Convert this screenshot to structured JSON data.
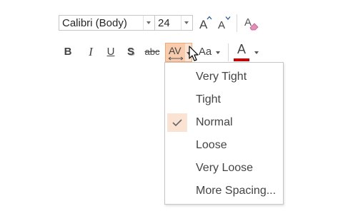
{
  "font_group": {
    "font_name": {
      "value": "Calibri (Body)"
    },
    "font_size": {
      "value": "24"
    },
    "grow_font_icon": "grow-font-icon",
    "shrink_font_icon": "shrink-font-icon",
    "clear_formatting_icon": "eraser-icon"
  },
  "format_buttons": {
    "bold": "B",
    "italic": "I",
    "underline": "U",
    "shadow": "S",
    "strikethrough": "abc",
    "character_spacing": "AV",
    "change_case": "Aa",
    "font_color": "A"
  },
  "colors": {
    "accent_highlight": "#f8cbad",
    "checked_background": "#fbe3d3",
    "font_color_bar": "#c00000",
    "menu_border": "#c6c6c6",
    "text": "#444444"
  },
  "spacing_menu": {
    "items": [
      {
        "label": "Very Tight",
        "checked": false
      },
      {
        "label": "Tight",
        "checked": false
      },
      {
        "label": "Normal",
        "checked": true
      },
      {
        "label": "Loose",
        "checked": false
      },
      {
        "label": "Very Loose",
        "checked": false
      },
      {
        "label": "More Spacing...",
        "checked": false
      }
    ]
  }
}
